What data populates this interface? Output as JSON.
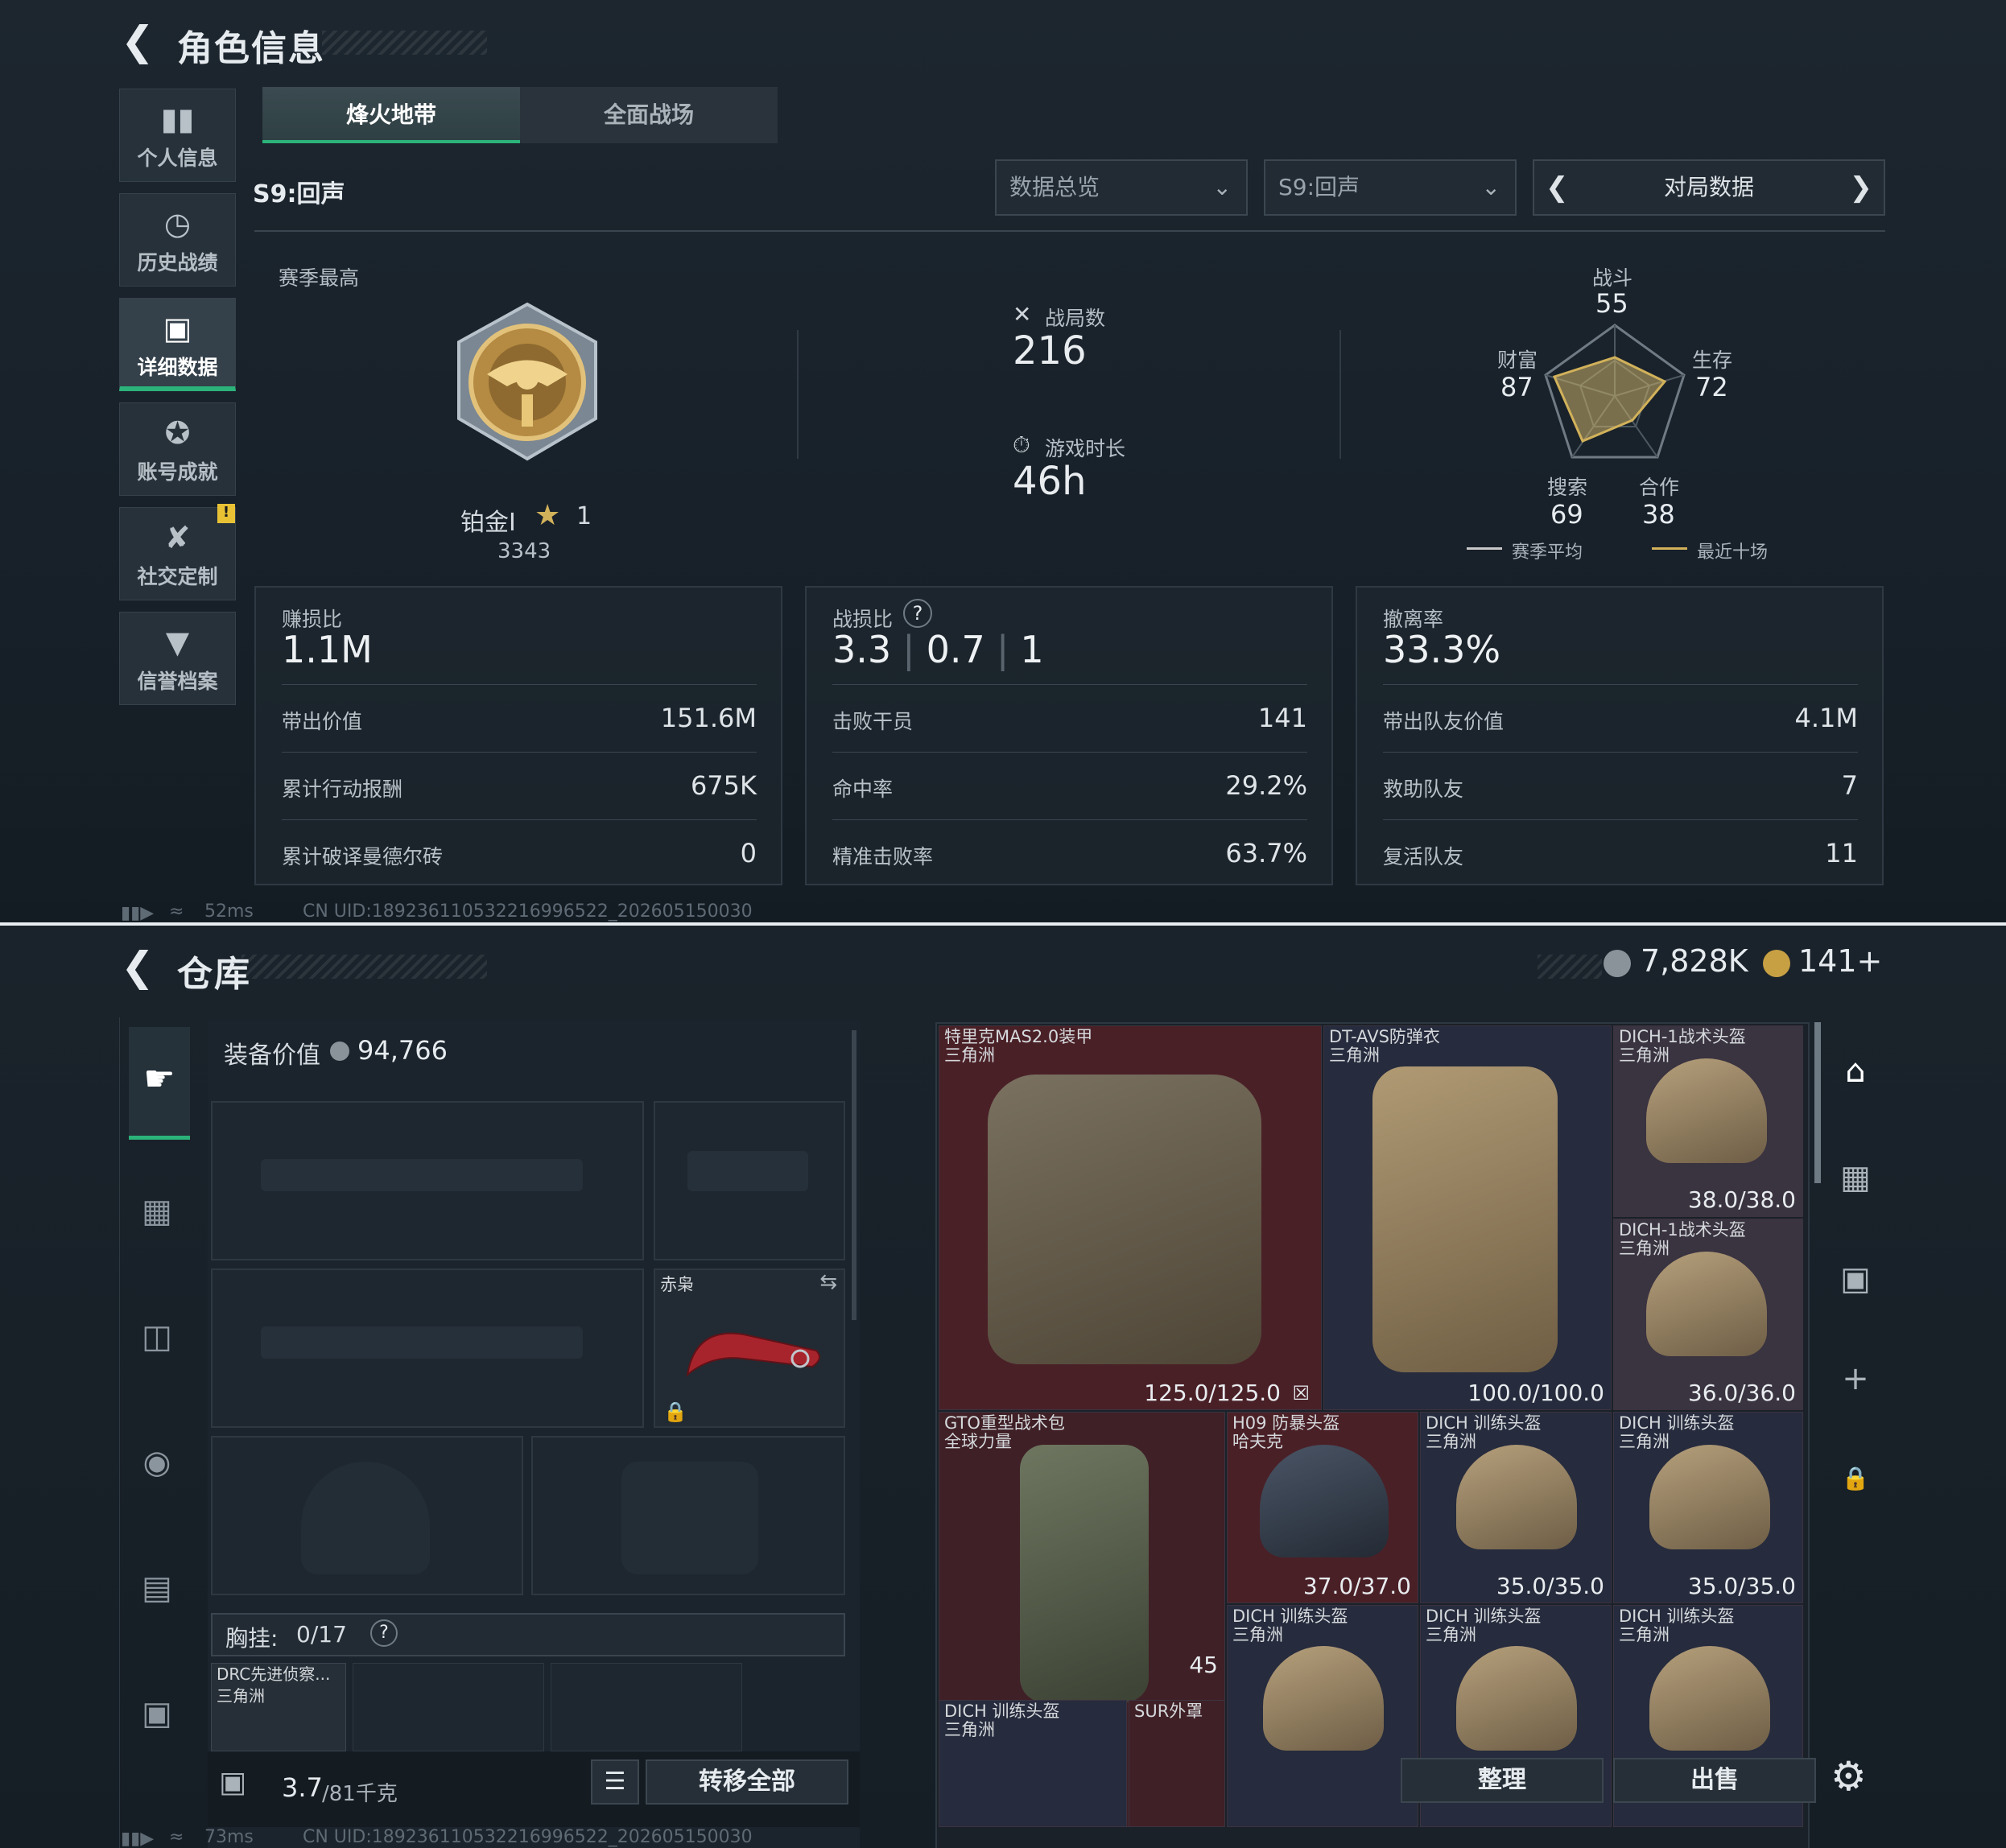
{
  "top": {
    "title": "角色信息",
    "nav": [
      {
        "label": "个人信息",
        "icon": "bar-chart-icon"
      },
      {
        "label": "历史战绩",
        "icon": "history-icon"
      },
      {
        "label": "详细数据",
        "icon": "folder-icon"
      },
      {
        "label": "账号成就",
        "icon": "achievement-icon"
      },
      {
        "label": "社交定制",
        "icon": "tools-icon"
      },
      {
        "label": "信誉档案",
        "icon": "shield-icon"
      }
    ],
    "tabs": [
      "烽火地带",
      "全面战场"
    ],
    "season": "S9:回声",
    "dropdowns": {
      "overview": "数据总览",
      "season": "S9:回声",
      "match": "对局数据"
    },
    "season_best_label": "赛季最高",
    "rank": {
      "name": "铂金I",
      "stars": "1",
      "score": "3343"
    },
    "matches_label": "战局数",
    "matches": "216",
    "playtime_label": "游戏时长",
    "playtime": "46h",
    "radar": {
      "labels": {
        "combat": "战斗",
        "survival": "生存",
        "cooperation": "合作",
        "search": "搜索",
        "wealth": "财富"
      },
      "values": {
        "combat": "55",
        "survival": "72",
        "cooperation": "38",
        "search": "69",
        "wealth": "87"
      },
      "season_avg_legend": "赛季平均",
      "recent_legend": "最近十场"
    },
    "box1": {
      "title": "赚损比",
      "value": "1.1M",
      "rows": [
        {
          "k": "带出价值",
          "v": "151.6M"
        },
        {
          "k": "累计行动报酬",
          "v": "675K"
        },
        {
          "k": "累计破译曼德尔砖",
          "v": "0"
        }
      ]
    },
    "box2": {
      "title": "战损比",
      "help": "?",
      "v1": "3.3",
      "v2": "0.7",
      "v3": "1",
      "rows": [
        {
          "k": "击败干员",
          "v": "141"
        },
        {
          "k": "命中率",
          "v": "29.2%"
        },
        {
          "k": "精准击败率",
          "v": "63.7%"
        }
      ]
    },
    "box3": {
      "title": "撤离率",
      "value": "33.3%",
      "rows": [
        {
          "k": "带出队友价值",
          "v": "4.1M"
        },
        {
          "k": "救助队友",
          "v": "7"
        },
        {
          "k": "复活队友",
          "v": "11"
        }
      ]
    },
    "ping": "52ms",
    "uid": "CN UID:18923611053221699652​2_202605150030"
  },
  "bot": {
    "title": "仓库",
    "currency1": "7,828K",
    "currency2": "141+",
    "equip_value_label": "装备价值",
    "equip_value": "94,766",
    "knife_name": "赤枭",
    "chest_label": "胸挂:",
    "chest_value": "0/17",
    "chest_help": "?",
    "chest_item": {
      "name": "DRC先进侦察...",
      "origin": "三角洲"
    },
    "weight": "3.7",
    "weight_max": "/81千克",
    "transfer_all": "转移全部",
    "sort": "整理",
    "sell": "出售",
    "ping": "73ms",
    "uid": "CN UID:18923611053221699652​2_202605150030",
    "items": [
      {
        "name": "特里克MAS2.0装甲",
        "origin": "三角洲",
        "dur": "125.0/125.0"
      },
      {
        "name": "DT-AVS防弹衣",
        "origin": "三角洲",
        "dur": "100.0/100.0"
      },
      {
        "name": "DICH-1战术头盔",
        "origin": "三角洲",
        "dur": "38.0/38.0"
      },
      {
        "name": "DICH-1战术头盔",
        "origin": "三角洲",
        "dur": "36.0/36.0"
      },
      {
        "name": "GTO重型战术包",
        "origin": "全球力量",
        "dur": "45"
      },
      {
        "name": "H09 防暴头盔",
        "origin": "哈夫克",
        "dur": "37.0/37.0"
      },
      {
        "name": "DICH 训练头盔",
        "origin": "三角洲",
        "dur": "35.0/35.0"
      },
      {
        "name": "DICH 训练头盔",
        "origin": "三角洲",
        "dur": "35.0/35.0"
      },
      {
        "name": "DICH 训练头盔",
        "origin": "三角洲",
        "dur": ""
      },
      {
        "name": "DICH 训练头盔",
        "origin": "三角洲",
        "dur": ""
      },
      {
        "name": "DICH 训练头盔",
        "origin": "三角洲",
        "dur": ""
      },
      {
        "name": "DICH 训练头盔",
        "origin": "三角洲",
        "dur": ""
      },
      {
        "name": "SUR外罩",
        "origin": "",
        "dur": ""
      }
    ]
  },
  "colors": {
    "accent": "#2bb37a",
    "item_red": "#4a2027",
    "item_blue": "#262b3d",
    "gold": "#d1b15a"
  }
}
